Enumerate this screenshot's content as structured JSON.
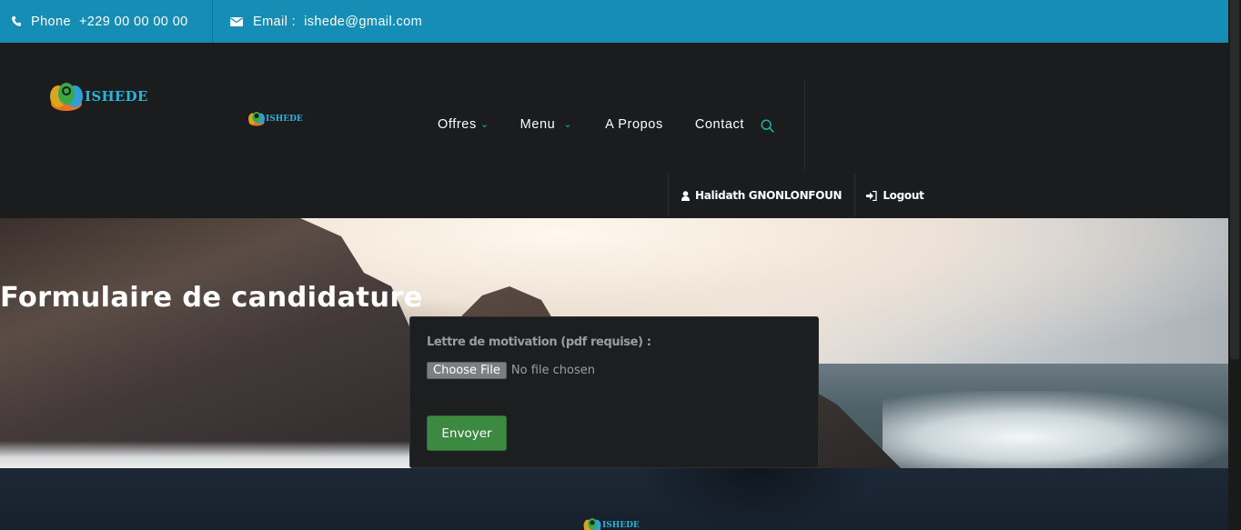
{
  "topbar": {
    "phone_label": "Phone",
    "phone_value": "+229 00 00 00 00",
    "email_label": "Email :",
    "email_value": "ishede@gmail.com"
  },
  "brand": {
    "name": "ISHEDE"
  },
  "nav": {
    "items": [
      {
        "label": "Offres",
        "has_dropdown": true
      },
      {
        "label": "Menu",
        "has_dropdown": true
      },
      {
        "label": "A Propos",
        "has_dropdown": false
      },
      {
        "label": "Contact",
        "has_dropdown": false
      }
    ],
    "search_icon": "search-icon"
  },
  "user": {
    "name": "Halidath GNONLONFOUN",
    "logout_label": "Logout",
    "user_icon": "user-icon",
    "logout_icon": "sign-in-icon"
  },
  "hero": {
    "title": "Formulaire de candidature"
  },
  "form": {
    "label": "Lettre de motivation (pdf requise) :",
    "file_button": "Choose File",
    "file_status": "No file chosen",
    "submit_label": "Envoyer"
  },
  "colors": {
    "topbar": "#158db4",
    "header": "#1b1c1e",
    "accent": "#1bb3a4",
    "submit": "#3c8a41",
    "footer": "#1c2836"
  }
}
